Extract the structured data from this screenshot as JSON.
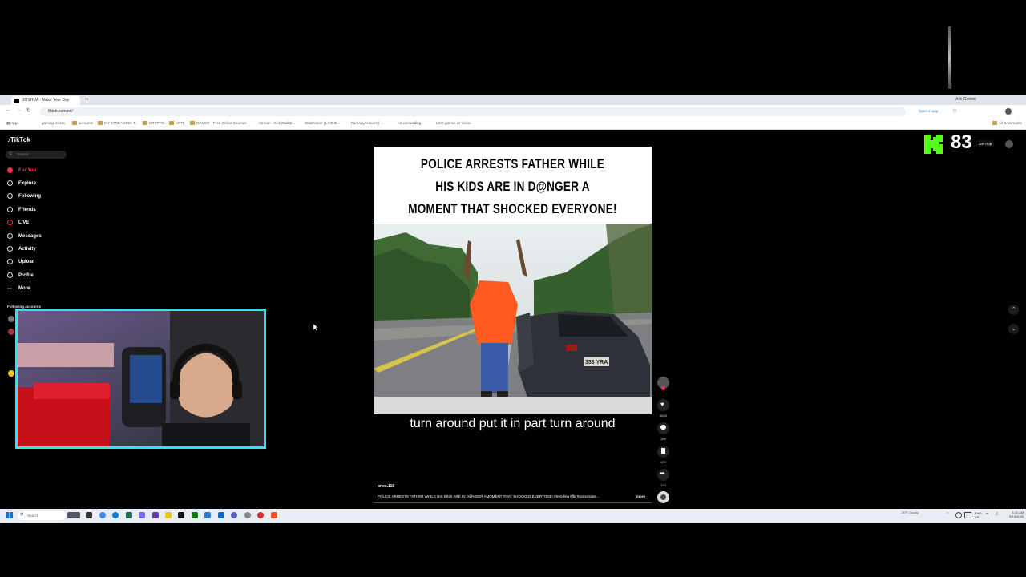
{
  "browser": {
    "tab_title": "JOSHUA - Make Your Day",
    "ask_gemini": "Ask Gemini",
    "url": "tiktok.com/en/",
    "open_in_app": "Open in app",
    "bookmarks": [
      "gaming tickets",
      "accounts",
      "MY STREAMING T...",
      "CRYPTO",
      "ARTI",
      "GAMER",
      "Free Online Courses",
      "Stream - Kick Dashb...",
      "Watchstars | LIVE B...",
      "FarhadyAccount | ...",
      "Kit.workcading",
      "LIVE games w/ Vision"
    ],
    "all_bookmarks": "All Bookmarks"
  },
  "tiktok": {
    "logo": "TikTok",
    "search_placeholder": "Search",
    "nav": [
      {
        "label": "For You"
      },
      {
        "label": "Explore"
      },
      {
        "label": "Following"
      },
      {
        "label": "Friends"
      },
      {
        "label": "LIVE"
      },
      {
        "label": "Messages"
      },
      {
        "label": "Activity"
      },
      {
        "label": "Upload"
      },
      {
        "label": "Profile"
      },
      {
        "label": "More"
      }
    ],
    "following_accounts": "Following accounts",
    "get_app": "Get App",
    "video": {
      "headline_lines": [
        "POLICE ARRESTS FATHER WHILE",
        "HIS KIDS ARE IN D@NGER A",
        "MOMENT THAT SHOCKED EVERYONE!"
      ],
      "plate": "353 YRA",
      "caption": "turn around put it in part turn around",
      "creator": "ones.116",
      "description": "POLICE ARRESTS FATHER WHILE HIS KIDS ARE IN D@NGER AMOMENT THAT SHOCKED EVERYONE! #trending #fbi #unitedstate...",
      "more": "more"
    },
    "actions": {
      "likes": "5843",
      "comments": "189",
      "saves": "429",
      "shares": "123"
    }
  },
  "overlay": {
    "viewer_count": "83"
  },
  "taskbar": {
    "search_placeholder": "Search",
    "weather": "78°F Cloudy",
    "time": "4:31 AM",
    "date": "8/19/2025"
  },
  "colors": {
    "tiktok_red": "#fe2c55",
    "webcam_border": "#2fe3f0",
    "kick_green": "#53fc18"
  }
}
